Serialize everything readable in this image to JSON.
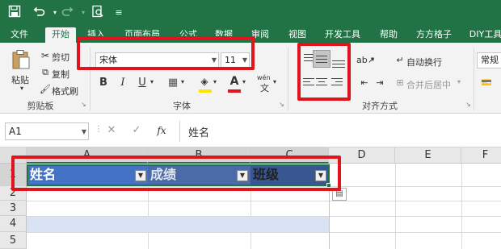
{
  "qat": {
    "save_icon": "save-icon",
    "undo_icon": "undo-icon",
    "redo_icon": "redo-icon",
    "preview_icon": "print-preview-icon",
    "customize_icon": "customize-icon"
  },
  "tabs": [
    "文件",
    "开始",
    "插入",
    "页面布局",
    "公式",
    "数据",
    "审阅",
    "视图",
    "开发工具",
    "帮助",
    "方方格子",
    "DIY工具"
  ],
  "clipboard": {
    "paste": "粘贴",
    "cut": "剪切",
    "copy": "复制",
    "format_painter": "格式刷",
    "label": "剪贴板"
  },
  "font": {
    "name": "宋体",
    "size": "11",
    "bold": "B",
    "italic": "I",
    "underline": "U",
    "label": "字体",
    "font_color": "#e0141c",
    "fill_color": "#ffe400",
    "wen": "wén"
  },
  "alignment": {
    "wrap_text": "自动换行",
    "merge_center": "合并后居中",
    "label": "对齐方式"
  },
  "number": {
    "format": "常规"
  },
  "formula_bar": {
    "name_box": "A1",
    "fx": "fx",
    "content": "姓名"
  },
  "grid": {
    "columns": [
      "A",
      "B",
      "C",
      "D",
      "E",
      "F"
    ],
    "rows": [
      "1",
      "2",
      "3",
      "4",
      "5"
    ],
    "header_cells": [
      "姓名",
      "成绩",
      "班级"
    ],
    "header_fill": [
      "#4472c4",
      "#4b6aa8",
      "#385691"
    ]
  },
  "colors": {
    "brand": "#217346",
    "highlight": "#e0141c",
    "band_row": "#dae3f3"
  }
}
